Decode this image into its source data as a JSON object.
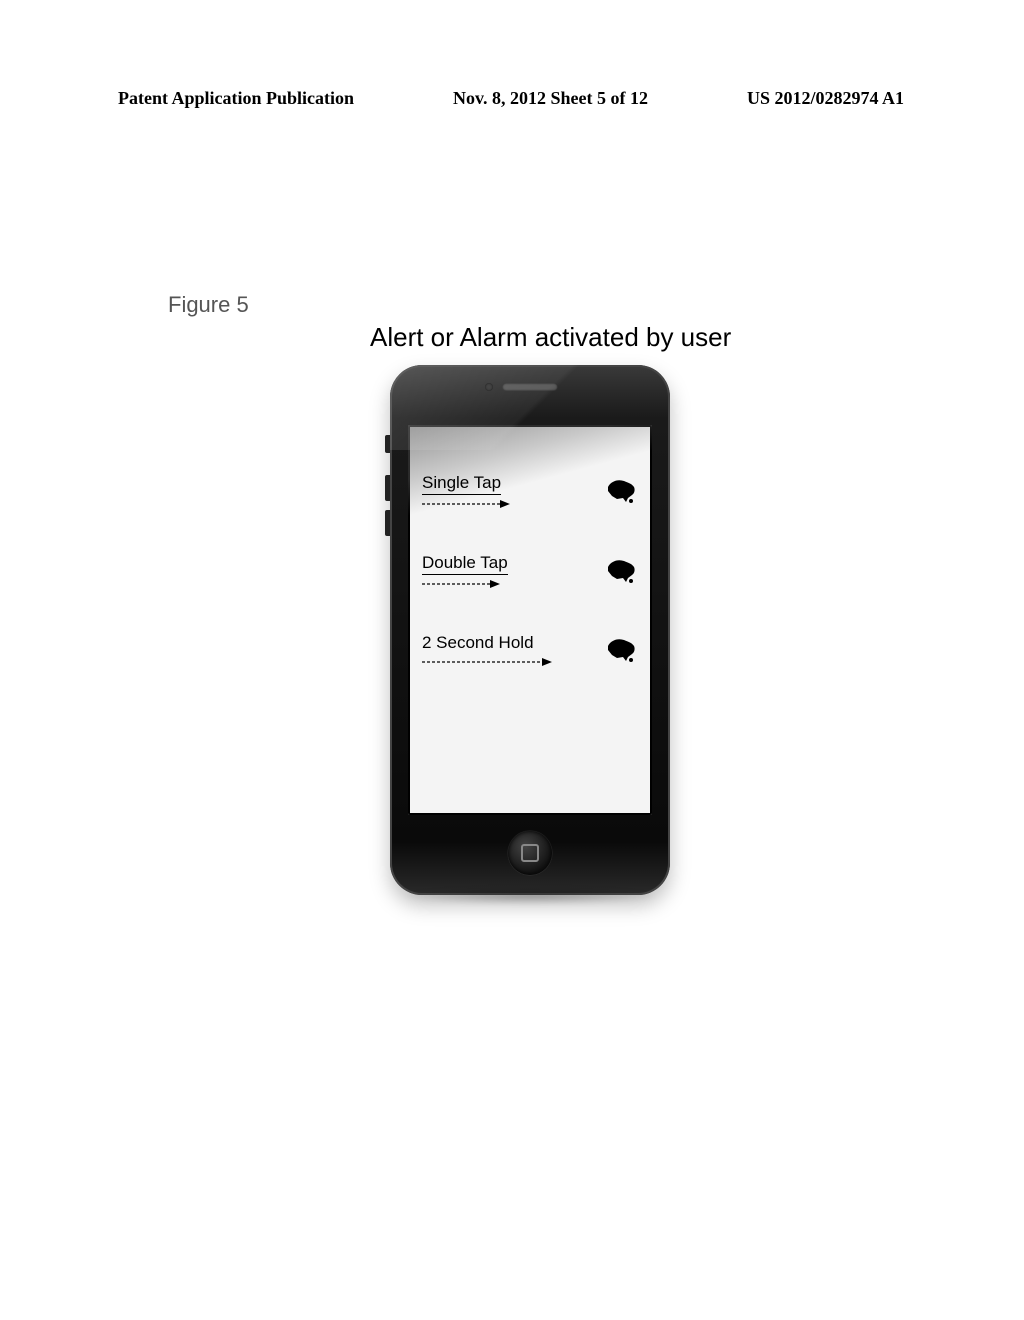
{
  "header": {
    "left": "Patent Application Publication",
    "center": "Nov. 8, 2012   Sheet 5 of 12",
    "right": "US 2012/0282974 A1"
  },
  "figure": {
    "label": "Figure 5",
    "title": "Alert or Alarm activated by user"
  },
  "gestures": [
    {
      "label": "Single Tap"
    },
    {
      "label": "Double Tap"
    },
    {
      "label": "2 Second Hold"
    }
  ]
}
